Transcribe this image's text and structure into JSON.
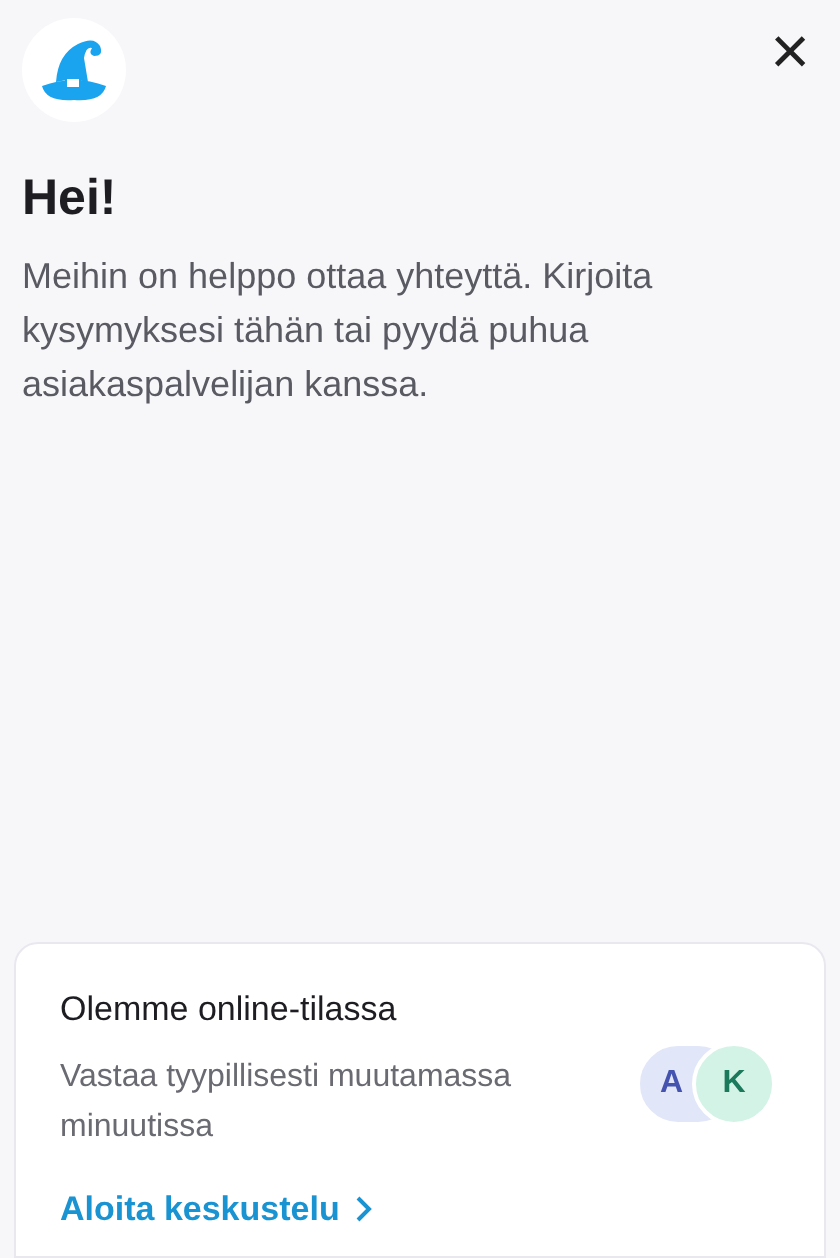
{
  "header": {
    "close": "×"
  },
  "greeting": {
    "title": "Hei!",
    "text": "Meihin on helppo ottaa yhteyttä. Kirjoita kysymyksesi tähän tai pyydä puhua asiakaspalvelijan kanssa."
  },
  "status_card": {
    "title": "Olemme online-tilassa",
    "subtitle": "Vastaa tyypillisesti muutamassa minuutissa",
    "link": "Aloita keskustelu",
    "avatars": [
      {
        "initial": "A",
        "color": "#e1e6f8"
      },
      {
        "initial": "K",
        "color": "#d3f3e6"
      }
    ]
  }
}
